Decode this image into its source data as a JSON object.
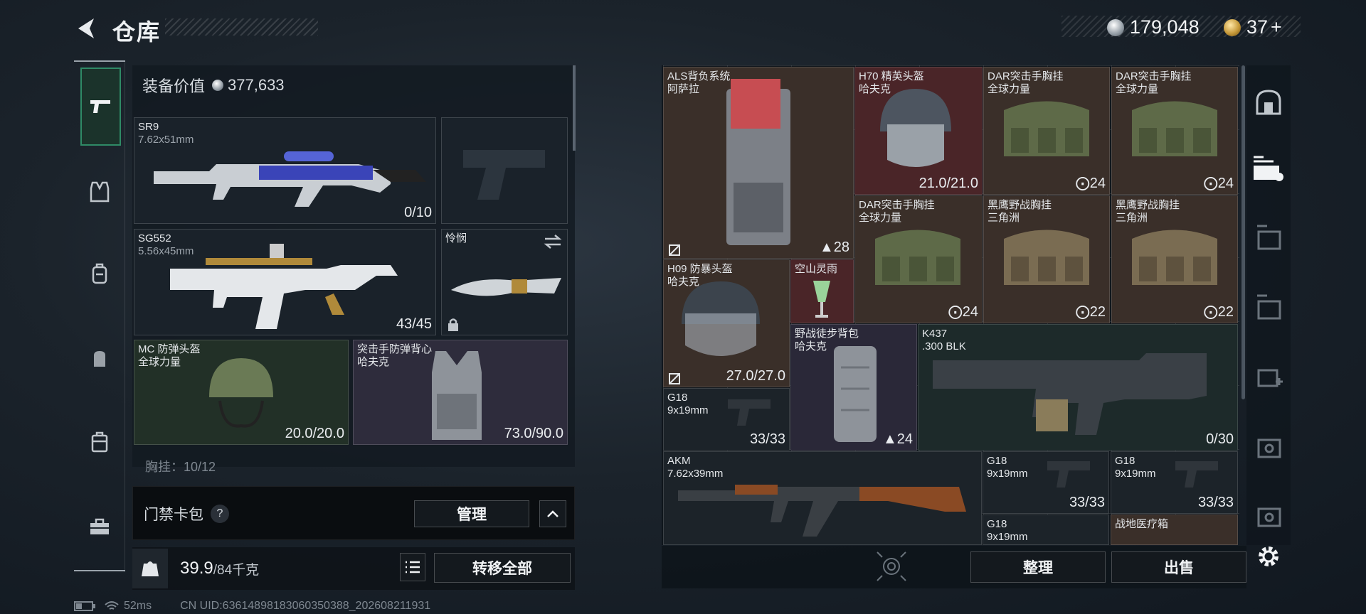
{
  "header": {
    "title": "仓库",
    "currency": [
      {
        "icon": "silver-coin-icon",
        "value": "179,048"
      },
      {
        "icon": "gold-coin-icon",
        "value": "37",
        "plus": "+"
      }
    ]
  },
  "left_sidebar": [
    "pistol-icon",
    "armor-vest-icon",
    "backpack-icon",
    "backpack-small-icon",
    "case-icon",
    "toolbox-icon"
  ],
  "equipment": {
    "value_label": "装备价值",
    "value": "377,633",
    "primary": {
      "name": "SR9",
      "caliber": "7.62x51mm",
      "count": "0/10"
    },
    "secondary": {
      "name": "SG552",
      "caliber": "5.56x45mm",
      "count": "43/45"
    },
    "melee": {
      "name": "怜悯"
    },
    "helmet": {
      "name": "MC 防弹头盔",
      "maker": "全球力量",
      "count": "20.0/20.0"
    },
    "armor": {
      "name": "突击手防弹背心",
      "maker": "哈夫克",
      "count": "73.0/90.0"
    },
    "partial_label": "胸挂：10/12"
  },
  "access_pack": {
    "label": "门禁卡包",
    "help": "?",
    "manage_label": "管理"
  },
  "weight": {
    "value": "39.9",
    "max": "/84千克",
    "transfer_label": "转移全部"
  },
  "stash_items": [
    {
      "name": "ALS背负系统",
      "maker": "阿萨拉",
      "count": "28"
    },
    {
      "name": "H70 精英头盔",
      "maker": "哈夫克",
      "count": "21.0/21.0"
    },
    {
      "name": "DAR突击手胸挂",
      "maker": "全球力量",
      "count": "24"
    },
    {
      "name": "DAR突击手胸挂",
      "maker": "全球力量",
      "count": "24"
    },
    {
      "name": "DAR突击手胸挂",
      "maker": "全球力量",
      "count": "24"
    },
    {
      "name": "黑鹰野战胸挂",
      "maker": "三角洲",
      "count": "22"
    },
    {
      "name": "黑鹰野战胸挂",
      "maker": "三角洲",
      "count": "22"
    },
    {
      "name": "H09 防暴头盔",
      "maker": "哈夫克",
      "count": "27.0/27.0"
    },
    {
      "name": "空山灵雨",
      "maker": "",
      "count": ""
    },
    {
      "name": "野战徒步背包",
      "maker": "哈夫克",
      "count": "24"
    },
    {
      "name": "K437",
      "maker": ".300 BLK",
      "count": "0/30"
    },
    {
      "name": "G18",
      "maker": "9x19mm",
      "count": "33/33"
    },
    {
      "name": "AKM",
      "maker": "7.62x39mm",
      "count": ""
    },
    {
      "name": "G18",
      "maker": "9x19mm",
      "count": "33/33"
    },
    {
      "name": "G18",
      "maker": "9x19mm",
      "count": "33/33"
    },
    {
      "name": "G18",
      "maker": "9x19mm",
      "count": ""
    },
    {
      "name": "战地医疗箱",
      "maker": "",
      "count": ""
    }
  ],
  "stash_actions": {
    "sort_label": "整理",
    "sell_label": "出售"
  },
  "right_sidebar": [
    "shelter-icon",
    "storage-tab-icon",
    "storage-iii-icon",
    "storage-iv-icon",
    "storage-iv-add-icon",
    "storage-iv-gear-icon",
    "storage-iv-slot-icon",
    "settings-gear-icon"
  ],
  "footer": {
    "ping": "52ms",
    "uid": "CN UID:63614898183060350388_202608211931"
  }
}
